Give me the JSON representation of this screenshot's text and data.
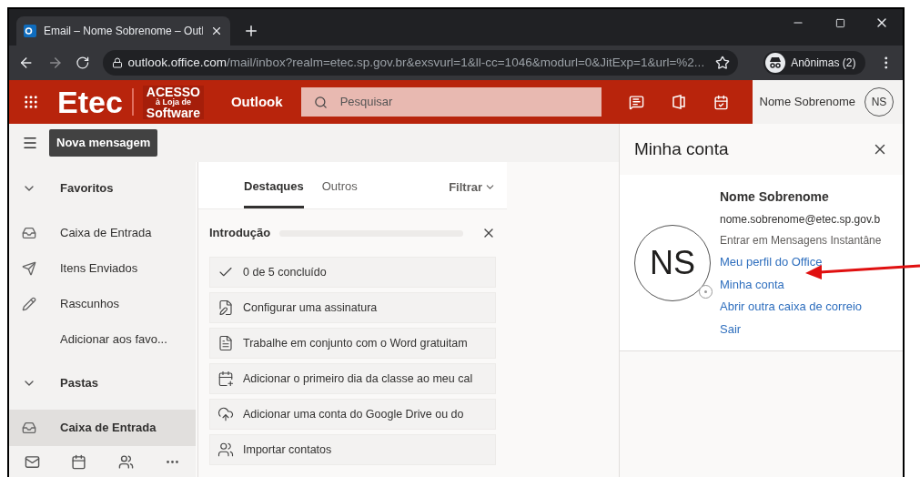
{
  "browser": {
    "tab_title": "Email – Nome Sobrenome – Outl",
    "url_host": "outlook.office.com",
    "url_path": "/mail/inbox?realm=etec.sp.gov.br&exsvurl=1&ll-cc=1046&modurl=0&JitExp=1&url=%2...",
    "profile": "Anônimas (2)"
  },
  "header": {
    "brand": "Etec",
    "logo_lines": [
      "ACESSO",
      "à Loja de",
      "Software"
    ],
    "app": "Outlook",
    "search": {
      "placeholder": "Pesquisar"
    },
    "user_name": "Nome Sobrenome",
    "initials": "NS"
  },
  "command_bar": {
    "new_message": "Nova mensagem"
  },
  "nav": {
    "sections": [
      {
        "label": "Favoritos",
        "expanded": true,
        "items": [
          {
            "label": "Caixa de Entrada",
            "selected": false
          },
          {
            "label": "Itens Enviados",
            "selected": false
          },
          {
            "label": "Rascunhos",
            "selected": false
          },
          {
            "label": "Adicionar aos favo...",
            "selected": false
          }
        ]
      },
      {
        "label": "Pastas",
        "expanded": true,
        "items": [
          {
            "label": "Caixa de Entrada",
            "selected": true
          }
        ]
      }
    ]
  },
  "message_list": {
    "tabs": [
      {
        "label": "Destaques",
        "selected": true
      },
      {
        "label": "Outros",
        "selected": false
      }
    ],
    "filter": "Filtrar",
    "intro": {
      "title": "Introdução",
      "tasks": [
        "0 de 5 concluído",
        "Configurar uma assinatura",
        "Trabalhe em conjunto com o Word gratuitam",
        "Adicionar o primeiro dia da classe ao meu cal",
        "Adicionar uma conta do Google Drive ou do",
        "Importar contatos"
      ]
    }
  },
  "account_panel": {
    "title": "Minha conta",
    "initials": "NS",
    "name": "Nome Sobrenome",
    "email": "nome.sobrenome@etec.sp.gov.b",
    "status": "Entrar em Mensagens Instantâne",
    "links": [
      "Meu perfil do Office",
      "Minha conta",
      "Abrir outra caixa de correio",
      "Sair"
    ]
  }
}
